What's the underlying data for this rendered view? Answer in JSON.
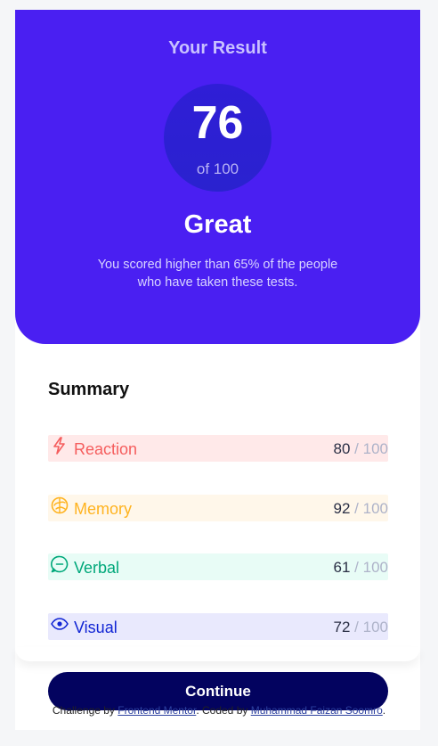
{
  "result": {
    "heading": "Your Result",
    "score": "76",
    "score_total": "of 100",
    "grade": "Great",
    "description": "You scored higher than 65% of the people who have taken these tests."
  },
  "summary": {
    "title": "Summary",
    "items": [
      {
        "category": "Reaction",
        "score": "80",
        "total": " / 100",
        "icon": "lightning-icon",
        "color": "#f55d5d",
        "bg": "#ffe9e9"
      },
      {
        "category": "Memory",
        "score": "92",
        "total": " / 100",
        "icon": "brain-icon",
        "color": "#ffb31f",
        "bg": "#fff7ea"
      },
      {
        "category": "Verbal",
        "score": "61",
        "total": " / 100",
        "icon": "chat-bubble-icon",
        "color": "#00a87a",
        "bg": "#e8fcf6"
      },
      {
        "category": "Visual",
        "score": "72",
        "total": " / 100",
        "icon": "eye-icon",
        "color": "#1125d4",
        "bg": "#e9e9fd"
      }
    ]
  },
  "continue_label": "Continue",
  "attribution": {
    "prefix": "Challenge by ",
    "link1": "Frontend Mentor",
    "middle": ". Coded by ",
    "link2": "Muhammad Faizan Soomro",
    "suffix": "."
  },
  "colors": {
    "accent": "#4a1ff2",
    "button": "#03035f"
  }
}
